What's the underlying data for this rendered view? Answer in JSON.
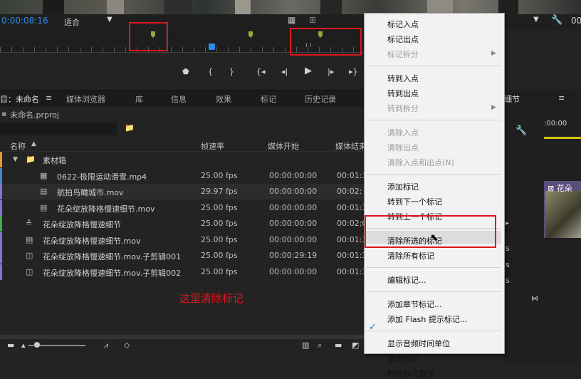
{
  "monitor": {
    "timecode": "0:00:08:16",
    "fit_label": "适合",
    "right_timecode": "00"
  },
  "project_panel": {
    "tabs": [
      "目：未命名",
      "媒体浏览器",
      "库",
      "信息",
      "效果",
      "标记",
      "历史记录"
    ],
    "project_file": "未命名.prproj",
    "columns": {
      "name": "名称",
      "fps": "帧速率",
      "start": "媒体开始",
      "end": "媒体结束"
    },
    "bin_name": "素材箱",
    "rows": [
      {
        "name": "0622-极限运动滑雪.mp4",
        "fps": "25.00 fps",
        "start": "00:00:00:00",
        "end": "00:01:3",
        "label_color": "#4a7fd6",
        "icon": "sequence-video-icon"
      },
      {
        "name": "航拍鸟瞰城市.mov",
        "fps": "29.97 fps",
        "start": "00:00:00:00",
        "end": "00:02:",
        "label_color": "#8a6fd6",
        "icon": "film-icon"
      },
      {
        "name": "花朵绽放降格慢速细节.mov",
        "fps": "25.00 fps",
        "start": "00:00:00:00",
        "end": "00:01:3",
        "label_color": "#8a6fd6",
        "icon": "film-icon"
      },
      {
        "name": "花朵绽放降格慢速细节",
        "fps": "25.00 fps",
        "start": "00:00:00:00",
        "end": "00:02:0",
        "label_color": "#3fb04a",
        "icon": "sequence-icon"
      },
      {
        "name": "花朵绽放降格慢速细节.mov",
        "fps": "25.00 fps",
        "start": "00:00:00:00",
        "end": "00:01:3",
        "label_color": "#8a6fd6",
        "icon": "film-icon"
      },
      {
        "name": "花朵绽放降格慢速细节.mov.子剪辑001",
        "fps": "25.00 fps",
        "start": "00:00:29:19",
        "end": "00:01:3",
        "label_color": "#8a6fd6",
        "icon": "subclip-icon"
      },
      {
        "name": "花朵绽放降格慢速细节.mov.子剪辑002",
        "fps": "25.00 fps",
        "start": "00:00:00:00",
        "end": "00:01:3",
        "label_color": "#8a6fd6",
        "icon": "subclip-icon"
      }
    ]
  },
  "annotation": "这里清除标记",
  "timeline": {
    "tab_label": "细节",
    "timecode": ":00:00",
    "clip_label": "花朵",
    "side_letters": [
      "s",
      "s",
      "s"
    ]
  },
  "context_menu": {
    "groups": [
      [
        {
          "label": "标记入点",
          "disabled": false,
          "submenu": false
        },
        {
          "label": "标记出点",
          "disabled": false,
          "submenu": false
        },
        {
          "label": "标记拆分",
          "disabled": true,
          "submenu": true
        }
      ],
      [
        {
          "label": "转到入点",
          "disabled": false,
          "submenu": false
        },
        {
          "label": "转到出点",
          "disabled": false,
          "submenu": false
        },
        {
          "label": "转到拆分",
          "disabled": true,
          "submenu": true
        }
      ],
      [
        {
          "label": "清除入点",
          "disabled": true,
          "submenu": false
        },
        {
          "label": "清除出点",
          "disabled": true,
          "submenu": false
        },
        {
          "label": "清除入点和出点(N)",
          "disabled": true,
          "submenu": false
        }
      ],
      [
        {
          "label": "添加标记",
          "disabled": false,
          "submenu": false
        },
        {
          "label": "转到下一个标记",
          "disabled": false,
          "submenu": false
        },
        {
          "label": "转到上一个标记",
          "disabled": false,
          "submenu": false
        }
      ],
      [
        {
          "label": "清除所选的标记",
          "disabled": false,
          "submenu": false
        },
        {
          "label": "清除所有标记",
          "disabled": false,
          "submenu": false
        }
      ],
      [
        {
          "label": "编辑标记...",
          "disabled": false,
          "submenu": false
        }
      ],
      [
        {
          "label": "添加章节标记...",
          "disabled": false,
          "submenu": false
        },
        {
          "label": "添加 Flash 提示标记...",
          "disabled": false,
          "submenu": false
        }
      ],
      [
        {
          "label": "显示音频时间单位",
          "disabled": false,
          "submenu": false
        },
        {
          "label": "显示标记",
          "disabled": false,
          "submenu": false,
          "checked": true
        },
        {
          "label": "时间标尺数字",
          "disabled": false,
          "submenu": false
        }
      ]
    ],
    "accent": "#e0161b"
  }
}
